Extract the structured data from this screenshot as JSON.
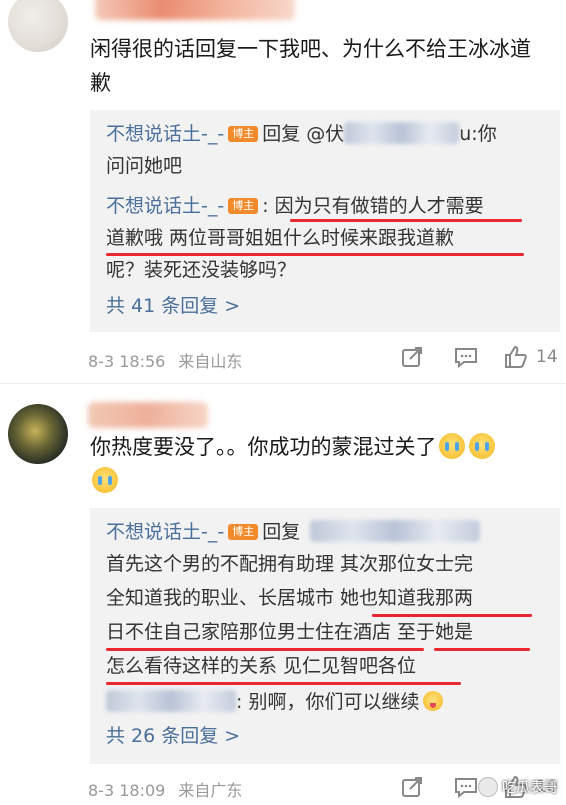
{
  "comments": [
    {
      "text": "闲得很的话回复一下我吧、为什么不给王冰冰道歉",
      "reply_rows": [
        {
          "user": "不想说话土-_-",
          "badge": "博主",
          "pre": "回复 @伏",
          "post": "u:你"
        },
        {
          "text": "问问她吧"
        },
        {
          "user": "不想说话土-_-",
          "badge": "博主",
          "text": ": 因为只有做错的人才需要"
        },
        {
          "text": "道歉哦 两位哥哥姐姐什么时候来跟我道歉"
        },
        {
          "text": "呢？装死还没装够吗？"
        }
      ],
      "more": "共 41 条回复 >",
      "time": "8-3 18:56",
      "source": "来自山东",
      "likes": "14"
    },
    {
      "text_line1": "你热度要没了。。你成功的蒙混过关了",
      "reply_rows": [
        {
          "user": "不想说话土-_-",
          "badge": "博主",
          "pre": "回复"
        },
        {
          "text": "首先这个男的不配拥有助理 其次那位女士完"
        },
        {
          "text": "全知道我的职业、长居城市 她也知道我那两"
        },
        {
          "text": "日不住自己家陪那位男士住在酒店 至于她是"
        },
        {
          "text": "怎么看待这样的关系 见仁见智吧各位"
        },
        {
          "text": ": 别啊，你们可以继续"
        }
      ],
      "more": "共 26 条回复 >",
      "time": "8-3 18:09",
      "source": "来自广东",
      "likes": "10"
    }
  ],
  "watermark": "吃瓜表哥",
  "icons": [
    "share-icon",
    "comment-icon",
    "like-icon",
    "crying-emoji-icon",
    "blushing-emoji-icon"
  ],
  "colors": {
    "username": "#4a6f9a",
    "badge": "#f08a2b",
    "highlight": "#e8272f",
    "reply_bg": "#f2f2f2"
  }
}
